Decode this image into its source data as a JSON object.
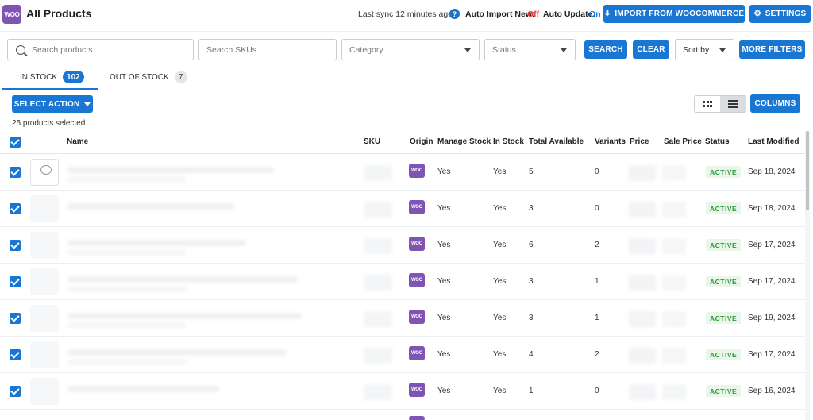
{
  "header": {
    "logo_text": "WOO",
    "title": "All Products",
    "last_sync": "Last sync 12 minutes ago",
    "help_icon": "?",
    "auto_import_label": "Auto Import New:",
    "auto_import_value": "Off",
    "auto_update_label": "Auto Update:",
    "auto_update_value": "On",
    "import_button": "IMPORT FROM WOOCOMMERCE",
    "settings_button": "SETTINGS",
    "colors": {
      "accent": "#1976d2",
      "brand": "#7f54b3",
      "off": "#e53935"
    }
  },
  "filters": {
    "search_placeholder": "Search products",
    "sku_placeholder": "Search SKUs",
    "category_placeholder": "Category",
    "status_placeholder": "Status",
    "search_button": "SEARCH",
    "clear_button": "CLEAR",
    "sort_label": "Sort by",
    "more_filters_button": "MORE FILTERS"
  },
  "tabs": [
    {
      "label": "IN STOCK",
      "count": "102",
      "active": true
    },
    {
      "label": "OUT OF STOCK",
      "count": "7",
      "active": false
    }
  ],
  "toolbar": {
    "select_action": "SELECT ACTION",
    "selected_text": "25 products selected",
    "view_options": [
      "grid-view-icon",
      "list-view-icon"
    ],
    "columns_button": "COLUMNS"
  },
  "table": {
    "headers": {
      "name": "Name",
      "sku": "SKU",
      "origin": "Origin",
      "manage_stock": "Manage Stock",
      "in_stock": "In Stock",
      "total_available": "Total Available",
      "variants": "Variants",
      "price": "Price",
      "sale_price": "Sale Price",
      "status": "Status",
      "last_modified": "Last Modified"
    },
    "origin_icon_text": "WOO",
    "rows": [
      {
        "manage_stock": "Yes",
        "in_stock": "Yes",
        "total_available": "5",
        "variants": "0",
        "status": "ACTIVE",
        "last_modified": "Sep 18, 2024"
      },
      {
        "manage_stock": "Yes",
        "in_stock": "Yes",
        "total_available": "3",
        "variants": "0",
        "status": "ACTIVE",
        "last_modified": "Sep 18, 2024"
      },
      {
        "manage_stock": "Yes",
        "in_stock": "Yes",
        "total_available": "6",
        "variants": "2",
        "status": "ACTIVE",
        "last_modified": "Sep 17, 2024"
      },
      {
        "manage_stock": "Yes",
        "in_stock": "Yes",
        "total_available": "3",
        "variants": "1",
        "status": "ACTIVE",
        "last_modified": "Sep 17, 2024"
      },
      {
        "manage_stock": "Yes",
        "in_stock": "Yes",
        "total_available": "3",
        "variants": "1",
        "status": "ACTIVE",
        "last_modified": "Sep 19, 2024"
      },
      {
        "manage_stock": "Yes",
        "in_stock": "Yes",
        "total_available": "4",
        "variants": "2",
        "status": "ACTIVE",
        "last_modified": "Sep 17, 2024"
      },
      {
        "manage_stock": "Yes",
        "in_stock": "Yes",
        "total_available": "1",
        "variants": "0",
        "status": "ACTIVE",
        "last_modified": "Sep 16, 2024"
      }
    ]
  }
}
